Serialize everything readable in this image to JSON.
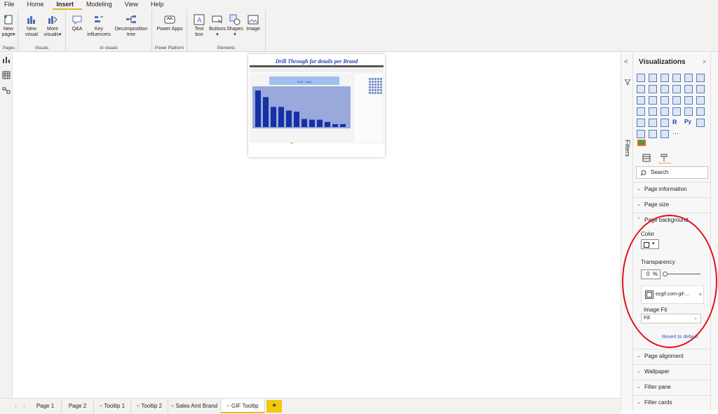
{
  "menu": [
    "File",
    "Home",
    "Insert",
    "Modeling",
    "View",
    "Help"
  ],
  "menu_active": "Insert",
  "ribbon": {
    "groups": [
      {
        "label": "Pages",
        "buttons": [
          {
            "label": "New page",
            "caret": "▾"
          }
        ]
      },
      {
        "label": "Visuals",
        "buttons": [
          {
            "label": "New visual"
          },
          {
            "label": "More visuals",
            "caret": "▾"
          }
        ]
      },
      {
        "label": "AI visuals",
        "buttons": [
          {
            "label": "Q&A"
          },
          {
            "label": "Key influencers"
          },
          {
            "label": "Decomposition tree"
          }
        ]
      },
      {
        "label": "Power Platform",
        "buttons": [
          {
            "label": "Power Apps"
          }
        ]
      },
      {
        "label": "Elements",
        "buttons": [
          {
            "label": "Text box"
          },
          {
            "label": "Buttons",
            "caret": "▾"
          },
          {
            "label": "Shapes",
            "caret": "▾"
          },
          {
            "label": "Image"
          }
        ]
      }
    ]
  },
  "report_page": {
    "title": "Drill Through for details per Brand",
    "inner_header": "2011 - May",
    "bar_values": [
      1.0,
      0.82,
      0.55,
      0.55,
      0.45,
      0.42,
      0.22,
      0.2,
      0.2,
      0.14,
      0.08,
      0.08
    ]
  },
  "filters_label": "Filters",
  "viz_panel": {
    "title": "Visualizations",
    "expand_icon": ">",
    "collapse_icon": "<",
    "search_placeholder": "Search",
    "sections_top": [
      "Page information",
      "Page size"
    ],
    "page_background": {
      "label": "Page background",
      "color_label": "Color",
      "swatch_color": "#ffffff",
      "transparency_label": "Transparency",
      "transparency_value": "0",
      "transparency_unit": "%",
      "image_file": "ezgif.com-gif-...",
      "remove": "×",
      "image_fit_label": "Image Fit",
      "image_fit_value": "Fill",
      "revert": "Revert to default"
    },
    "sections_bottom": [
      "Page alignment",
      "Wallpaper",
      "Filter pane",
      "Filter cards"
    ]
  },
  "page_tabs": [
    "Page 1",
    "Page 2",
    "Tooltip 1",
    "Tooltip 2",
    "Sales Amt Brand",
    "GIF Tooltip"
  ],
  "active_tab": "GIF Tooltip",
  "add_tab": "+",
  "colors": {
    "accent": "#e8b42c",
    "annotation": "#e0111d",
    "bars": "#1531a3",
    "plot_bg": "#9aa9dc"
  }
}
